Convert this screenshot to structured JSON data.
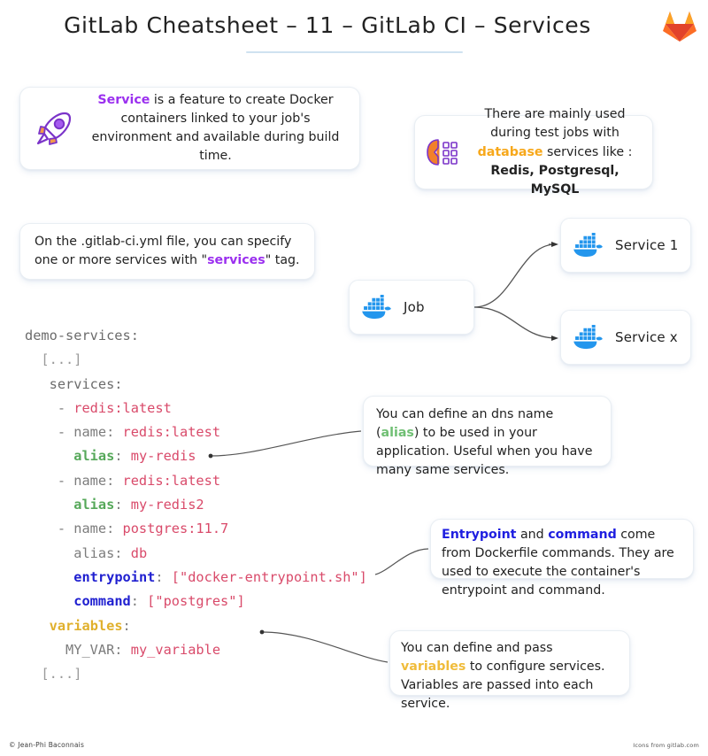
{
  "header": {
    "title": "GitLab Cheatsheet – 11 – GitLab CI – Services",
    "logo_icon": "gitlab-logo-icon",
    "rule_color": "#cfe2f0"
  },
  "cards": {
    "service": {
      "icon": "rocket-icon",
      "keyword": "Service",
      "keyword_color": "#9b30ef",
      "text_after": " is a feature to create Docker containers linked to your job's environment and available during build time."
    },
    "test_jobs": {
      "icon": "services-gear-icon",
      "line1_a": "There are mainly used during test jobs with ",
      "keyword": "database",
      "keyword_color": "#f7a81b",
      "line1_b": " services like :",
      "line2": "Redis, Postgresql, MySQL"
    },
    "yml_file": {
      "text_a": "On the .gitlab-ci.yml file, you can specify one or more services with \"",
      "keyword": "services",
      "keyword_color": "#9b30ef",
      "text_b": "\" tag."
    },
    "alias": {
      "text_a": "You can define an dns name (",
      "keyword": "alias",
      "keyword_color": "#6fbf73",
      "text_b": ") to be used in your application. Useful when you have many same services."
    },
    "entrypoint": {
      "keyword1": "Entrypoint",
      "mid": " and ",
      "keyword2": "command",
      "keyword_color": "#1f1fe0",
      "text_b": " come from Dockerfile commands. They are used to execute the container's entrypoint and command."
    },
    "variables": {
      "text_a": "You can define and pass ",
      "keyword": "variables",
      "keyword_color": "#f0bc3b",
      "text_b": " to configure services.",
      "line2": "Variables are passed into each service."
    }
  },
  "diagram": {
    "nodes": [
      {
        "id": "job",
        "label": "Job",
        "icon": "docker-whale-icon"
      },
      {
        "id": "service1",
        "label": "Service 1",
        "icon": "docker-whale-icon"
      },
      {
        "id": "servicex",
        "label": "Service x",
        "icon": "docker-whale-icon"
      }
    ],
    "edges": [
      {
        "from": "job",
        "to": "service1"
      },
      {
        "from": "job",
        "to": "servicex"
      }
    ],
    "docker_blue": "#2396ed"
  },
  "code": {
    "lines": [
      [
        {
          "t": "demo-services:",
          "c": "c-key"
        }
      ],
      [
        {
          "t": "  [...]",
          "c": "c-dim"
        }
      ],
      [
        {
          "t": "   services:",
          "c": "c-key"
        }
      ],
      [
        {
          "t": "    - ",
          "c": "c-plain"
        },
        {
          "t": "redis:latest",
          "c": "c-str"
        }
      ],
      [
        {
          "t": "    - name: ",
          "c": "c-plain"
        },
        {
          "t": "redis:latest",
          "c": "c-str"
        }
      ],
      [
        {
          "t": "      ",
          "c": "c-plain"
        },
        {
          "t": "alias",
          "c": "c-alias"
        },
        {
          "t": ": ",
          "c": "c-plain"
        },
        {
          "t": "my-redis",
          "c": "c-str"
        }
      ],
      [
        {
          "t": "    - name: ",
          "c": "c-plain"
        },
        {
          "t": "redis:latest",
          "c": "c-str"
        }
      ],
      [
        {
          "t": "      ",
          "c": "c-plain"
        },
        {
          "t": "alias",
          "c": "c-alias"
        },
        {
          "t": ": ",
          "c": "c-plain"
        },
        {
          "t": "my-redis2",
          "c": "c-str"
        }
      ],
      [
        {
          "t": "    - name: ",
          "c": "c-plain"
        },
        {
          "t": "postgres:11.7",
          "c": "c-str"
        }
      ],
      [
        {
          "t": "      alias: ",
          "c": "c-plain"
        },
        {
          "t": "db",
          "c": "c-str"
        }
      ],
      [
        {
          "t": "      ",
          "c": "c-plain"
        },
        {
          "t": "entrypoint",
          "c": "c-blue"
        },
        {
          "t": ": ",
          "c": "c-plain"
        },
        {
          "t": "[\"docker-entrypoint.sh\"]",
          "c": "c-str"
        }
      ],
      [
        {
          "t": "      ",
          "c": "c-plain"
        },
        {
          "t": "command",
          "c": "c-blue"
        },
        {
          "t": ": ",
          "c": "c-plain"
        },
        {
          "t": "[\"postgres\"]",
          "c": "c-str"
        }
      ],
      [
        {
          "t": "   ",
          "c": "c-plain"
        },
        {
          "t": "variables",
          "c": "c-var"
        },
        {
          "t": ":",
          "c": "c-plain"
        }
      ],
      [
        {
          "t": "     MY_VAR: ",
          "c": "c-plain"
        },
        {
          "t": "my_variable",
          "c": "c-str"
        }
      ],
      [
        {
          "t": "  [...]",
          "c": "c-dim"
        }
      ]
    ]
  },
  "footer": {
    "author": "© Jean-Phi Baconnais",
    "credit": "Icons from gitlab.com"
  }
}
